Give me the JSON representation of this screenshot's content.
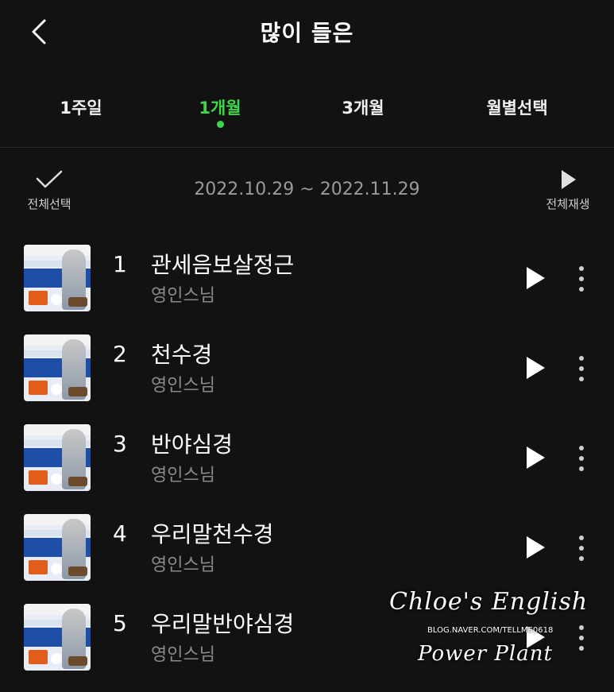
{
  "header": {
    "title": "많이 들은",
    "back_icon": "chevron-left-icon"
  },
  "tabs": [
    {
      "label": "1주일",
      "active": false
    },
    {
      "label": "1개월",
      "active": true
    },
    {
      "label": "3개월",
      "active": false
    },
    {
      "label": "월별선택",
      "active": false
    }
  ],
  "accent_color": "#3fd54a",
  "toolbar": {
    "select_all_label": "전체선택",
    "date_range": "2022.10.29 ~ 2022.11.29",
    "play_all_label": "전체재생"
  },
  "tracks": [
    {
      "rank": "1",
      "title": "관세음보살정근",
      "artist": "영인스님"
    },
    {
      "rank": "2",
      "title": "천수경",
      "artist": "영인스님"
    },
    {
      "rank": "3",
      "title": "반야심경",
      "artist": "영인스님"
    },
    {
      "rank": "4",
      "title": "우리말천수경",
      "artist": "영인스님"
    },
    {
      "rank": "5",
      "title": "우리말반야심경",
      "artist": "영인스님"
    }
  ],
  "watermark": {
    "line1": "Chloe's English",
    "line2": "BLOG.NAVER.COM/TELLME0618",
    "line3": "Power Plant"
  }
}
